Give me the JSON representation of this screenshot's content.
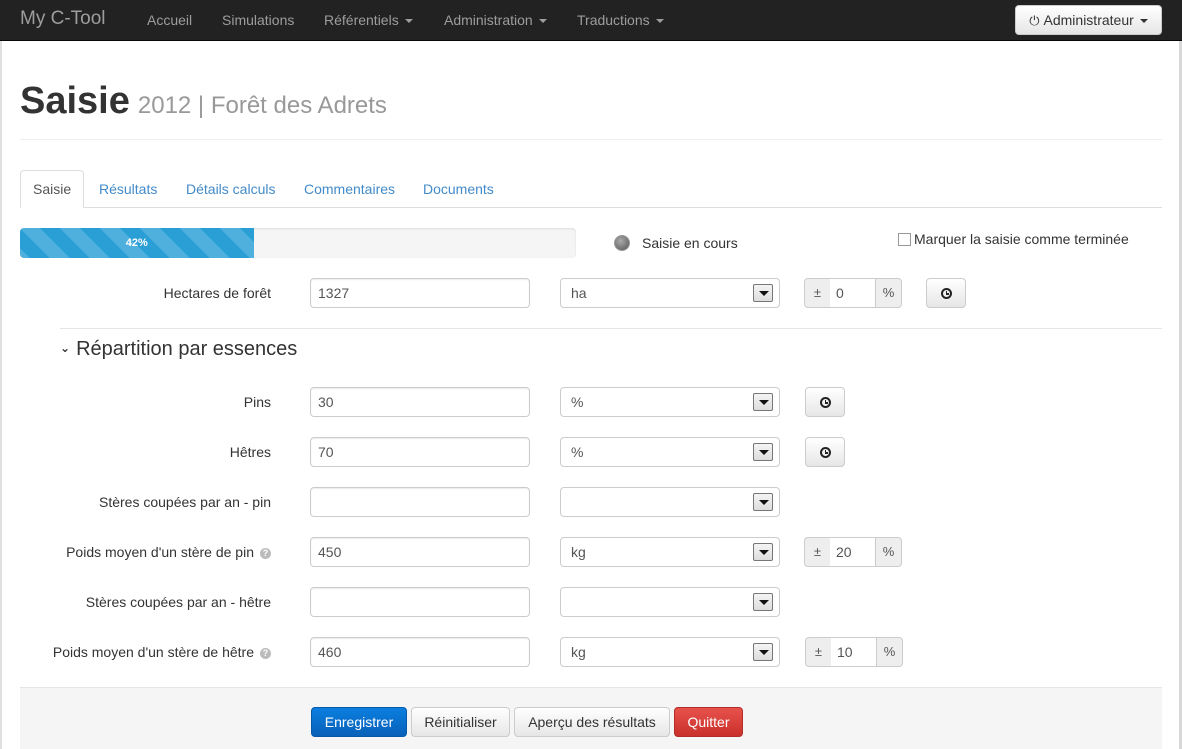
{
  "navbar": {
    "brand": "My C-Tool",
    "items": [
      {
        "label": "Accueil"
      },
      {
        "label": "Simulations"
      },
      {
        "label": "Référentiels"
      },
      {
        "label": "Administration"
      },
      {
        "label": "Traductions"
      }
    ],
    "user_label": "Administrateur"
  },
  "header": {
    "title": "Saisie",
    "subtitle": "2012 | Forêt des Adrets"
  },
  "tabs": [
    {
      "label": "Saisie",
      "active": true
    },
    {
      "label": "Résultats"
    },
    {
      "label": "Détails calculs"
    },
    {
      "label": "Commentaires"
    },
    {
      "label": "Documents"
    }
  ],
  "progress": {
    "percent": 42,
    "label": "42%",
    "status_text": "Saisie en cours",
    "finished_checkbox_label": "Marquer la saisie comme terminée",
    "finished_checked": false
  },
  "fields": {
    "hectares": {
      "label": "Hectares de forêt",
      "value": "1327",
      "unit": "ha",
      "uncertainty_prefix": "±",
      "uncertainty": "0",
      "uncertainty_suffix": "%"
    },
    "section_title": "Répartition par essences",
    "pins": {
      "label": "Pins",
      "value": "30",
      "unit": "%"
    },
    "hetres": {
      "label": "Hêtres",
      "value": "70",
      "unit": "%"
    },
    "steres_pin": {
      "label": "Stères coupées par an - pin",
      "value": "",
      "unit": ""
    },
    "poids_pin": {
      "label": "Poids moyen d'un stère de pin",
      "value": "450",
      "unit": "kg",
      "uncertainty_prefix": "±",
      "uncertainty": "20",
      "uncertainty_suffix": "%"
    },
    "steres_hetre": {
      "label": "Stères coupées par an - hêtre",
      "value": "",
      "unit": ""
    },
    "poids_hetre": {
      "label": "Poids moyen d'un stère de hêtre",
      "value": "460",
      "unit": "kg",
      "uncertainty_prefix": "±",
      "uncertainty": "10",
      "uncertainty_suffix": "%"
    }
  },
  "actions": {
    "save": "Enregistrer",
    "reset": "Réinitialiser",
    "preview": "Aperçu des résultats",
    "quit": "Quitter"
  },
  "colors": {
    "navbar": "#222222",
    "progress": "#2a9fd6",
    "link": "#428bca",
    "primary": "#0860b8",
    "danger": "#c9302c"
  }
}
